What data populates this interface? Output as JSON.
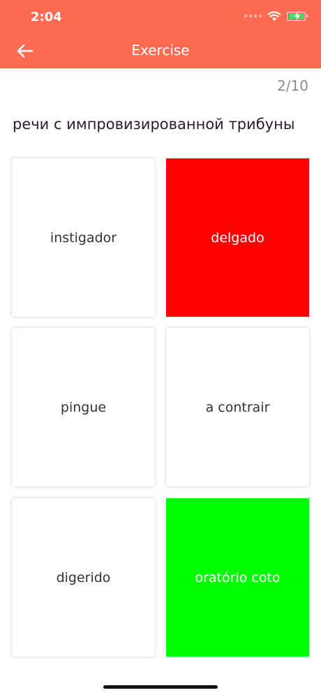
{
  "status_bar": {
    "time": "2:04",
    "icons": [
      "cellular-dots-icon",
      "wifi-icon",
      "battery-charging-icon"
    ]
  },
  "nav": {
    "title": "Exercise",
    "back_icon": "arrow-left-icon"
  },
  "progress": "2/10",
  "question": "речи с импровизированной трибуны",
  "options": [
    {
      "label": "instigador",
      "state": "default"
    },
    {
      "label": "delgado",
      "state": "wrong"
    },
    {
      "label": "pingue",
      "state": "default"
    },
    {
      "label": "a contrair",
      "state": "default"
    },
    {
      "label": "digerido",
      "state": "default"
    },
    {
      "label": "oratório coto",
      "state": "correct"
    }
  ],
  "colors": {
    "header": "#ff6a53",
    "wrong": "#ff0000",
    "correct": "#00ff00",
    "question_text": "#2e1733"
  }
}
